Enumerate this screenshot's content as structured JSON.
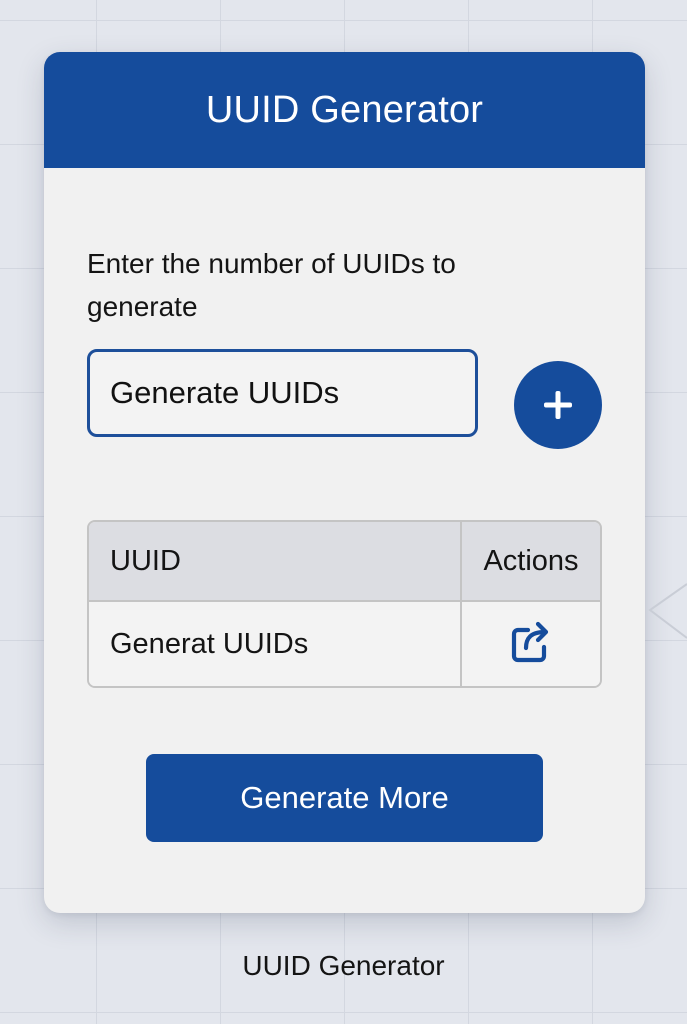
{
  "app": {
    "title": "UUID Generator",
    "accent_color": "#154c9c"
  },
  "form": {
    "prompt": "Enter the number of UUIDs to generate",
    "input_placeholder": "Generate UUIDs",
    "add_icon": "plus-icon"
  },
  "table": {
    "headers": {
      "uuid": "UUID",
      "actions": "Actions"
    },
    "rows": [
      {
        "uuid": "Generat UUIDs",
        "action_icon": "share-icon"
      }
    ]
  },
  "actions": {
    "generate_more_label": "Generate More"
  },
  "footer": {
    "caption": "UUID Generator"
  }
}
